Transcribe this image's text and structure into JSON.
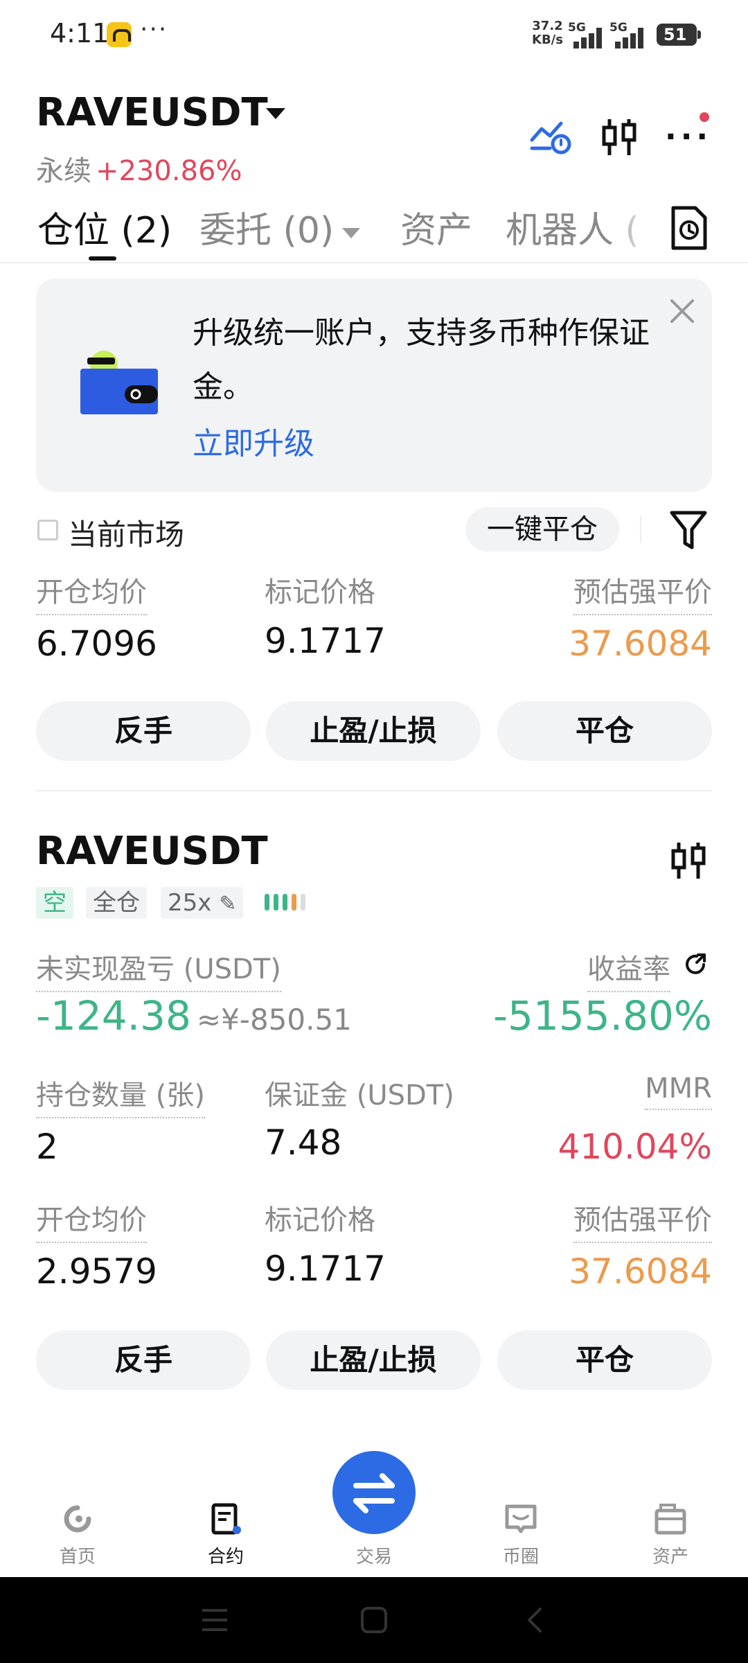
{
  "status_bar": {
    "time": "4:11",
    "more": "···",
    "net_speed": "37.2",
    "net_unit": "KB/s",
    "signal1": "5G",
    "signal2": "5G",
    "battery": "51"
  },
  "header": {
    "symbol": "RAVEUSDT",
    "type": "永续",
    "change_pct": "+230.86%",
    "more": "···"
  },
  "tabs": [
    {
      "label": "仓位 (2)",
      "active": true
    },
    {
      "label": "委托 (0)",
      "active": false
    },
    {
      "label": "资产",
      "active": false
    },
    {
      "label": "机器人 (",
      "active": false
    }
  ],
  "banner": {
    "text": "升级统一账户，支持多币种作保证金。",
    "link": "立即升级"
  },
  "filter": {
    "current_market": "当前市场",
    "close_all": "一键平仓"
  },
  "position1": {
    "entry_label": "开仓均价",
    "entry_value": "6.7096",
    "mark_label": "标记价格",
    "mark_value": "9.1717",
    "liq_label": "预估强平价",
    "liq_value": "37.6084",
    "btn_reverse": "反手",
    "btn_tpsl": "止盈/止损",
    "btn_close": "平仓"
  },
  "position2": {
    "symbol": "RAVEUSDT",
    "side": "空",
    "margin_mode": "全仓",
    "leverage": "25x",
    "unreal_label": "未实现盈亏 (USDT)",
    "unreal_value": "-124.38",
    "unreal_cny": "≈¥-850.51",
    "roe_label": "收益率",
    "roe_value": "-5155.80%",
    "qty_label": "持仓数量 (张)",
    "qty_value": "2",
    "margin_label": "保证金 (USDT)",
    "margin_value": "7.48",
    "mmr_label": "MMR",
    "mmr_value": "410.04%",
    "entry_label": "开仓均价",
    "entry_value": "2.9579",
    "mark_label": "标记价格",
    "mark_value": "9.1717",
    "liq_label": "预估强平价",
    "liq_value": "37.6084",
    "btn_reverse": "反手",
    "btn_tpsl": "止盈/止损",
    "btn_close": "平仓"
  },
  "bottom_nav": {
    "home": "首页",
    "contract": "合约",
    "trade": "交易",
    "community": "币圈",
    "assets": "资产"
  },
  "colors": {
    "accent": "#2d6be4",
    "up": "#e0465c",
    "down": "#3db586",
    "liq": "#ec9a4c"
  }
}
